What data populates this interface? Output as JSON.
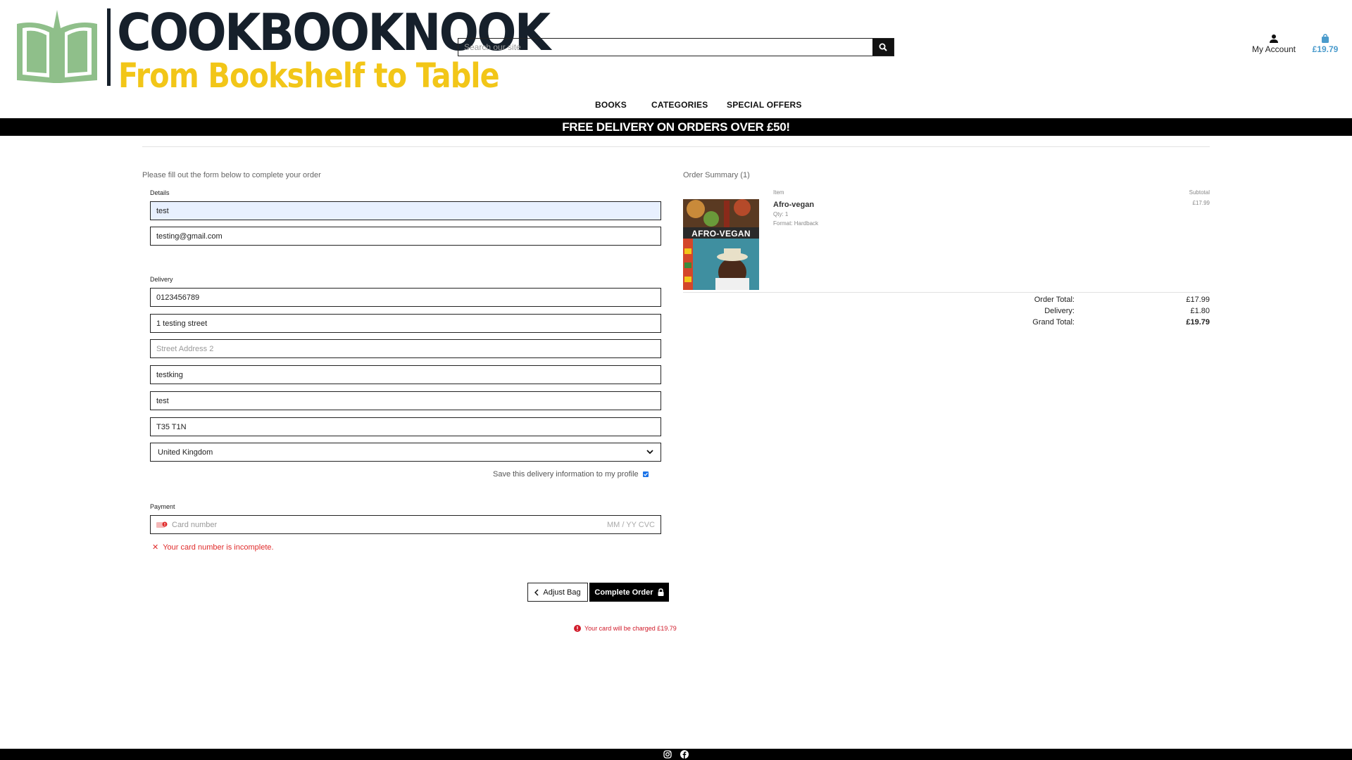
{
  "header": {
    "brand": "COOKBOOKNOOK",
    "tagline": "From Bookshelf to Table",
    "search_placeholder": "Search our site",
    "account_label": "My Account",
    "bag_total": "£19.79",
    "icons": [
      "book-logo-icon",
      "search-icon",
      "user-icon",
      "shopping-bag-icon"
    ]
  },
  "nav": {
    "books": "BOOKS",
    "categories": "CATEGORIES",
    "special_offers": "SPECIAL OFFERS"
  },
  "banner": "FREE DELIVERY ON ORDERS OVER £50!",
  "form": {
    "intro": "Please fill out the form below to complete your order",
    "details_label": "Details",
    "full_name": "test",
    "email": "testing@gmail.com",
    "delivery_label": "Delivery",
    "phone": "0123456789",
    "street1": "1 testing street",
    "street2_placeholder": "Street Address 2",
    "town": "testking",
    "county": "test",
    "postcode": "T35 T1N",
    "country": "United Kingdom",
    "save_info": "Save this delivery information to my profile",
    "save_info_checked": true,
    "payment_label": "Payment",
    "card_placeholder": "Card number",
    "card_extra": "MM / YY  CVC",
    "card_error": "Your card number is incomplete.",
    "adjust_bag": "Adjust Bag",
    "complete_order": "Complete Order",
    "charge_note": "Your card will be charged £19.79"
  },
  "summary": {
    "title": "Order Summary (1)",
    "item_header": "Item",
    "subtotal_header": "Subtotal",
    "book_cover_title": "AFRO-VEGAN",
    "item": {
      "name": "Afro-vegan",
      "qty": "Qty: 1",
      "format": "Format: Hardback",
      "subtotal": "£17.99"
    },
    "order_total_label": "Order Total:",
    "order_total": "£17.99",
    "delivery_label": "Delivery:",
    "delivery": "£1.80",
    "grand_total_label": "Grand Total:",
    "grand_total": "£19.79"
  },
  "colors": {
    "brand_dark": "#16202b",
    "brand_yellow": "#f2c618",
    "logo_green": "#8fbf8a",
    "bag_blue": "#4a9bcc",
    "error_red": "#e02b2b"
  }
}
